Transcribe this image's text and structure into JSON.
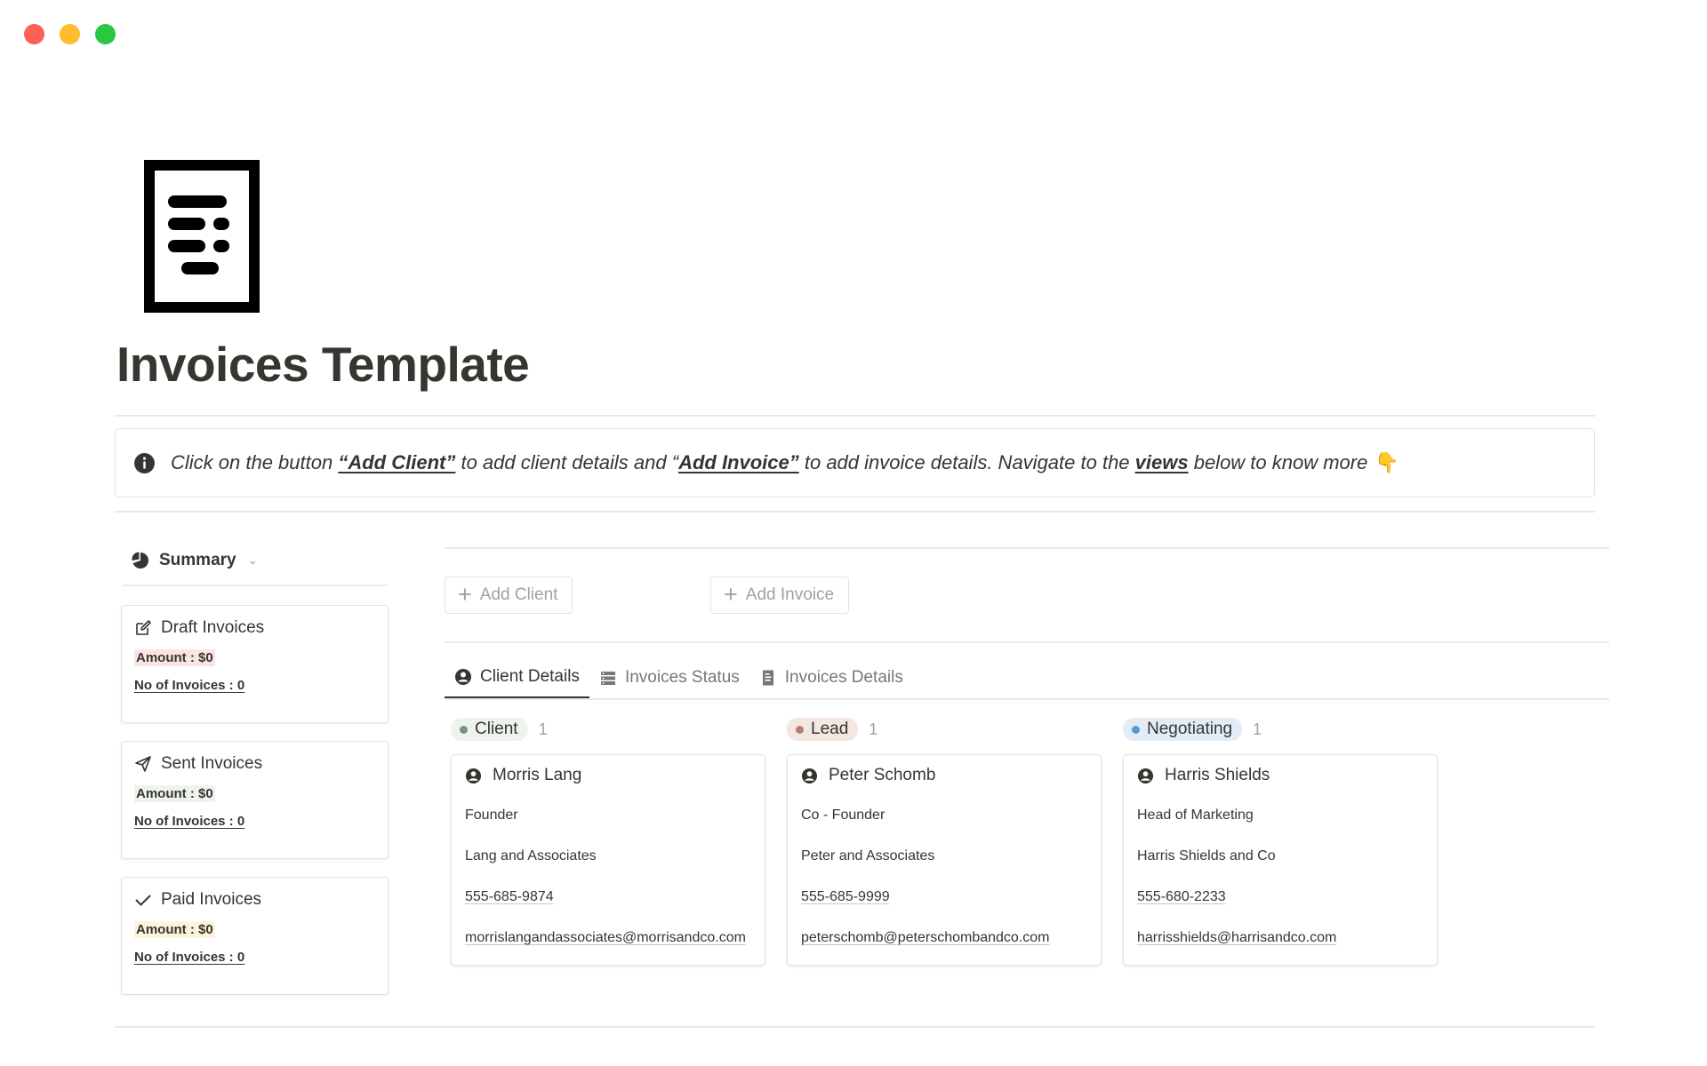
{
  "window": {
    "controls": [
      "close",
      "minimize",
      "zoom"
    ]
  },
  "page": {
    "title": "Invoices Template",
    "icon": "invoice-document-icon"
  },
  "callout": {
    "icon": "info-icon",
    "part1": "Click on the button ",
    "link1": "“Add Client”",
    "part2": " to add client details and “",
    "link2": "Add Invoice”",
    "part3": " to add invoice details. Navigate to the ",
    "link3": "views",
    "part4": " below to know more",
    "emoji": "👇"
  },
  "summary": {
    "label": "Summary",
    "icon": "pie-chart-icon",
    "cards": [
      {
        "title": "Draft Invoices",
        "icon": "edit-icon",
        "amount": "Amount : $0",
        "count": "No of Invoices : 0",
        "highlight": "#fbe4e4"
      },
      {
        "title": "Sent Invoices",
        "icon": "send-icon",
        "amount": "Amount : $0",
        "count": "No of Invoices : 0",
        "highlight": "#eef3ed"
      },
      {
        "title": "Paid Invoices",
        "icon": "check-icon",
        "amount": "Amount : $0",
        "count": "No of Invoices : 0",
        "highlight": "#fbf3db"
      }
    ]
  },
  "buttons": {
    "add_client": "Add Client",
    "add_invoice": "Add Invoice"
  },
  "tabs": [
    {
      "label": "Client Details",
      "icon": "person-circle-icon",
      "active": true
    },
    {
      "label": "Invoices Status",
      "icon": "list-icon",
      "active": false
    },
    {
      "label": "Invoices Details",
      "icon": "receipt-icon",
      "active": false
    }
  ],
  "board": {
    "columns": [
      {
        "status": "Client",
        "count": "1",
        "pill_bg": "#eef3ed",
        "dot": "#6c9b7d",
        "card": {
          "name": "Morris Lang",
          "role": "Founder",
          "company": "Lang and Associates",
          "phone": "555-685-9874",
          "email": "morrislangandassociates@morrisandco.com"
        }
      },
      {
        "status": "Lead",
        "count": "1",
        "pill_bg": "#f4e6e0",
        "dot": "#b97f6c",
        "card": {
          "name": "Peter Schomb",
          "role": "Co - Founder",
          "company": "Peter and Associates",
          "phone": "555-685-9999",
          "email": "peterschomb@peterschombandco.com"
        }
      },
      {
        "status": "Negotiating",
        "count": "1",
        "pill_bg": "#e2edf7",
        "dot": "#5b97d0",
        "card": {
          "name": "Harris Shields",
          "role": "Head of Marketing",
          "company": "Harris Shields and Co",
          "phone": "555-680-2233",
          "email": "harrisshields@harrisandco.com"
        }
      }
    ]
  }
}
